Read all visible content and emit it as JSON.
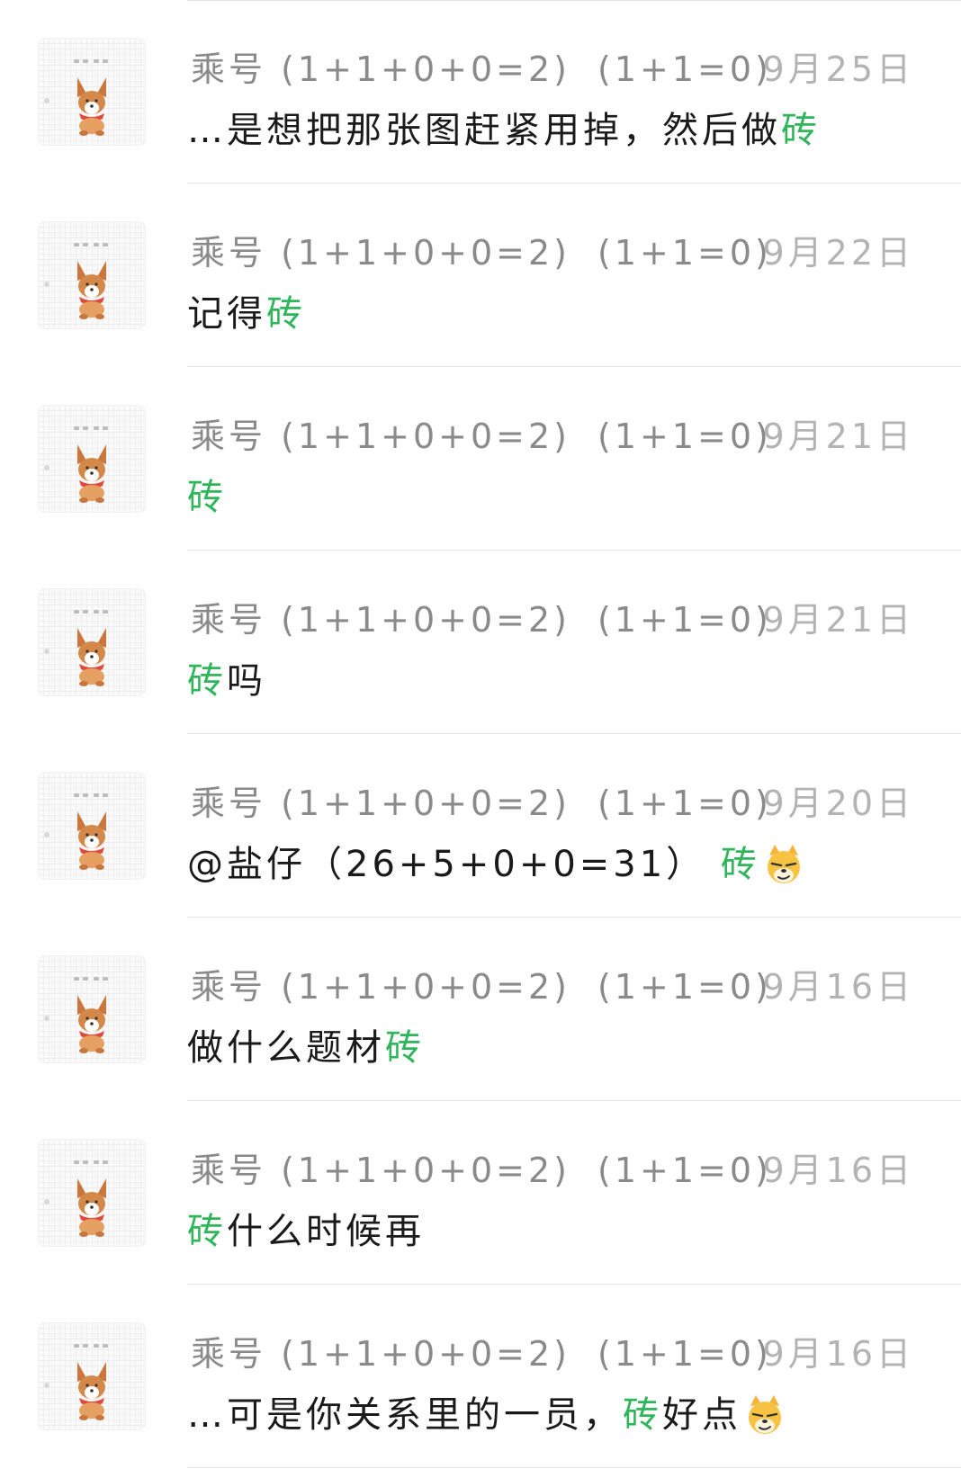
{
  "colors": {
    "keyword": "#2fb55a",
    "name": "#8a8a8a",
    "date": "#b3b3b3",
    "text": "#1a1a1a"
  },
  "items": [
    {
      "name": "乘号",
      "score_a": "(1+1+0+0=2)",
      "score_b": "(1+1=0)",
      "date": "9月25日",
      "pre": "…是想把那张图赶紧用掉，然后做",
      "kw": "砖",
      "post": "",
      "emoji": ""
    },
    {
      "name": "乘号",
      "score_a": "(1+1+0+0=2)",
      "score_b": "(1+1=0)",
      "date": "9月22日",
      "pre": "记得",
      "kw": "砖",
      "post": "",
      "emoji": ""
    },
    {
      "name": "乘号",
      "score_a": "(1+1+0+0=2)",
      "score_b": "(1+1=0)",
      "date": "9月21日",
      "pre": "",
      "kw": "砖",
      "post": "",
      "emoji": ""
    },
    {
      "name": "乘号",
      "score_a": "(1+1+0+0=2)",
      "score_b": "(1+1=0)",
      "date": "9月21日",
      "pre": "",
      "kw": "砖",
      "post": "吗",
      "emoji": ""
    },
    {
      "name": "乘号",
      "score_a": "(1+1+0+0=2)",
      "score_b": "(1+1=0)",
      "date": "9月20日",
      "pre": "@盐仔（26+5+0+0=31） ",
      "kw": "砖",
      "post": "",
      "emoji": "smirk-emoji"
    },
    {
      "name": "乘号",
      "score_a": "(1+1+0+0=2)",
      "score_b": "(1+1=0)",
      "date": "9月16日",
      "pre": "做什么题材",
      "kw": "砖",
      "post": "",
      "emoji": ""
    },
    {
      "name": "乘号",
      "score_a": "(1+1+0+0=2)",
      "score_b": "(1+1=0)",
      "date": "9月16日",
      "pre": "",
      "kw": "砖",
      "post": "什么时候再",
      "emoji": ""
    },
    {
      "name": "乘号",
      "score_a": "(1+1+0+0=2)",
      "score_b": "(1+1=0)",
      "date": "9月16日",
      "pre": "…可是你关系里的一员，",
      "kw": "砖",
      "post": "好点",
      "emoji": "smirk-emoji"
    }
  ]
}
